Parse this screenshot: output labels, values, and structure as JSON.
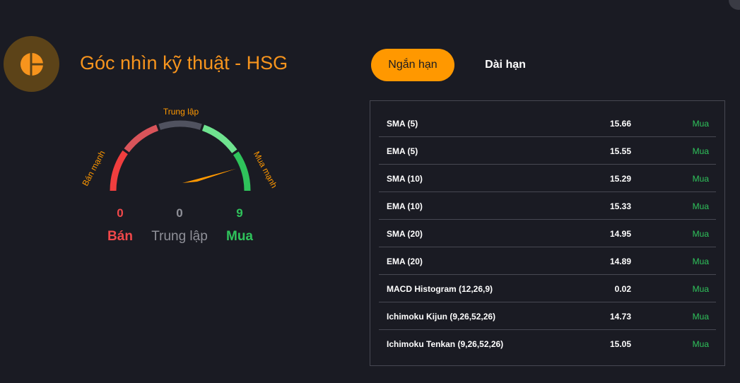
{
  "header": {
    "title": "Góc nhìn kỹ thuật - HSG"
  },
  "tabs": [
    {
      "label": "Ngắn hạn",
      "active": true
    },
    {
      "label": "Dài hạn",
      "active": false
    }
  ],
  "gauge": {
    "labels": {
      "strong_sell": "Bán mạnh",
      "neutral": "Trung lập",
      "strong_buy": "Mua mạnh"
    },
    "needle_level": 0.88,
    "colors": {
      "strong_sell": "#f03e3e",
      "sell": "#d9545a",
      "neutral": "#50525f",
      "buy": "#6fe38f",
      "strong_buy": "#2fc35b",
      "needle": "#ff9800",
      "label": "#ff9800"
    }
  },
  "summary": {
    "sell": {
      "count": "0",
      "label": "Bán"
    },
    "neutral": {
      "count": "0",
      "label": "Trung lập"
    },
    "buy": {
      "count": "9",
      "label": "Mua"
    }
  },
  "indicators": [
    {
      "name": "SMA (5)",
      "value": "15.66",
      "signal": "Mua"
    },
    {
      "name": "EMA (5)",
      "value": "15.55",
      "signal": "Mua"
    },
    {
      "name": "SMA (10)",
      "value": "15.29",
      "signal": "Mua"
    },
    {
      "name": "EMA (10)",
      "value": "15.33",
      "signal": "Mua"
    },
    {
      "name": "SMA (20)",
      "value": "14.95",
      "signal": "Mua"
    },
    {
      "name": "EMA (20)",
      "value": "14.89",
      "signal": "Mua"
    },
    {
      "name": "MACD Histogram (12,26,9)",
      "value": "0.02",
      "signal": "Mua"
    },
    {
      "name": "Ichimoku Kijun (9,26,52,26)",
      "value": "14.73",
      "signal": "Mua"
    },
    {
      "name": "Ichimoku Tenkan (9,26,52,26)",
      "value": "15.05",
      "signal": "Mua"
    }
  ]
}
